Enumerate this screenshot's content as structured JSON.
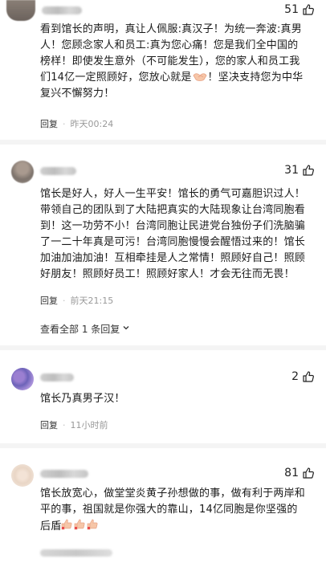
{
  "comments": [
    {
      "likes": "51",
      "text": "看到馆长的声明，真让人佩服:真汉子！为统一奔波:真男\n人！您顾念家人和员工:真为您心痛！您是我们全中国的\n榜样！即使发生意外（不可能发生），您的家人和员工我\n们14亿一定照顾好，您放心就是",
      "text_tail": "！坚决支持您为中华\n复兴不懈努力！",
      "emoji": "handshake",
      "reply_label": "回复",
      "time": "昨天00:24"
    },
    {
      "likes": "31",
      "text": "馆长是好人，好人一生平安！馆长的勇气可嘉胆识过人！\n带领自己的团队到了大陆把真实的大陆现象让台湾同胞看\n到！这一功劳不小！台湾同胞让民进党台独份子们洗脑骗\n了一二十年真是可污！台湾同胞慢慢会醒悟过来的！馆长\n加油加油加油！互相牵挂是人之常情！照顾好自己！照顾\n好朋友！照顾好员工！照顾好家人！才会无往而无畏！",
      "reply_label": "回复",
      "time": "前天21:15",
      "view_all": "查看全部 1 条回复"
    },
    {
      "likes": "2",
      "text": "馆长乃真男子汉！",
      "reply_label": "回复",
      "time": "11小时前"
    },
    {
      "likes": "81",
      "text": "馆长放宽心，做堂堂炎黄子孙想做的事，做有利于两岸和\n平的事，祖国就是你强大的靠山，14亿同胞是你坚强的\n后盾",
      "emoji": "thumbs-up-x3"
    }
  ],
  "icons": {
    "like": "thumbs-up-outline-icon",
    "chevron": "chevron-down-icon"
  },
  "colors": {
    "meta_gray": "#999999",
    "emoji_skin": "#f6c6a8",
    "emoji_red": "#e94b4b"
  }
}
